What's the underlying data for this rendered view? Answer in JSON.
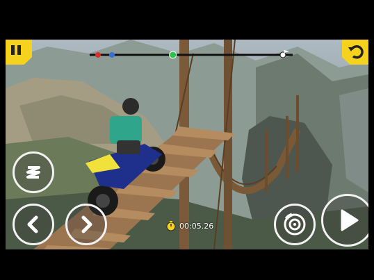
{
  "hud": {
    "timer": "00:05.26",
    "track_progress": 0.41
  },
  "icons": {
    "pause": "pause-icon",
    "restart": "restart-icon",
    "lean": "lean-zigzag-icon",
    "lean_back": "chevron-left-icon",
    "lean_forward": "chevron-right-icon",
    "brake": "brake-disc-icon",
    "throttle": "play-triangle-icon",
    "timer": "stopwatch-icon",
    "finish": "finish-flag-icon"
  },
  "colors": {
    "accent": "#f4d21e",
    "progress_marker": "#2ec24a",
    "checkpoint_red": "#d9302b",
    "checkpoint_blue": "#3a6fd6",
    "rider_shirt": "#2fa58c",
    "bike": "#1f2f8c"
  }
}
